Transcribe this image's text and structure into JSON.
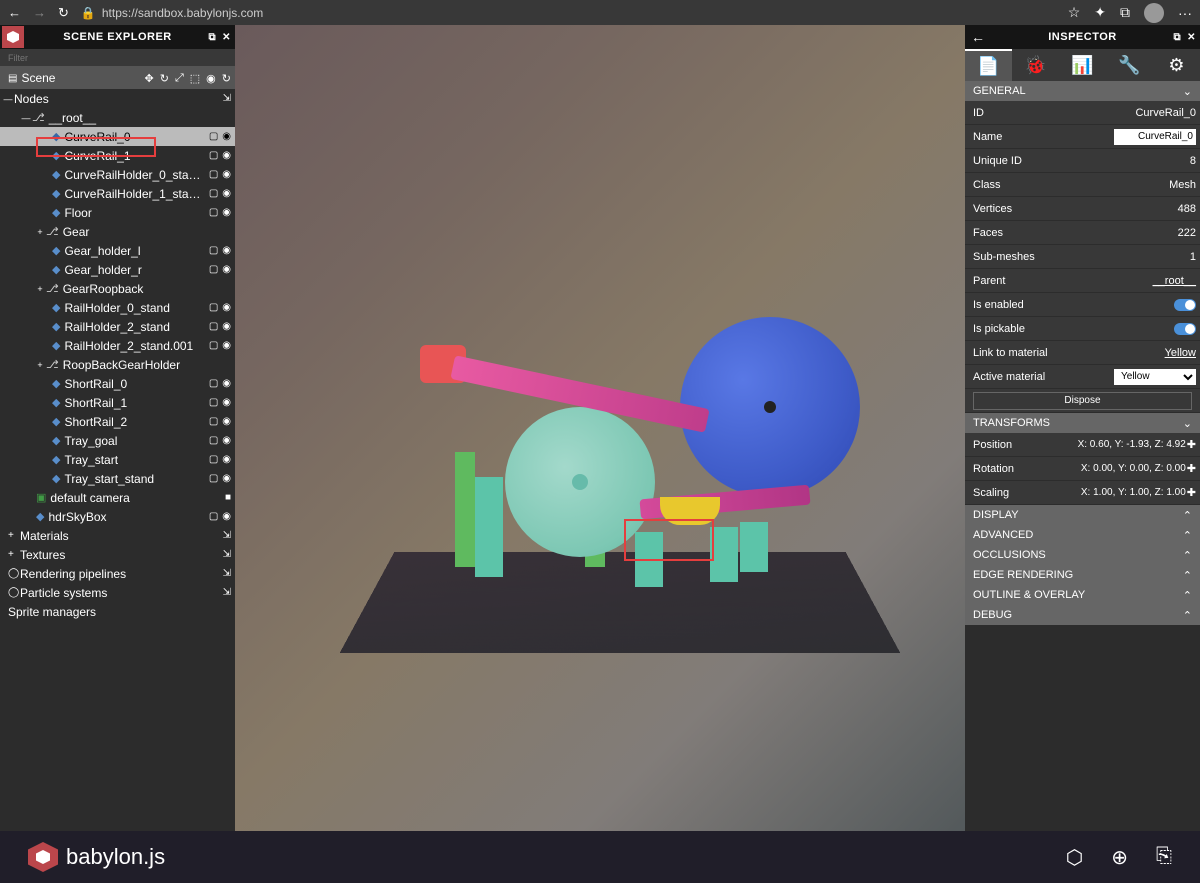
{
  "browser": {
    "url": "https://sandbox.babylonjs.com"
  },
  "scene_explorer": {
    "title": "SCENE EXPLORER",
    "filter_placeholder": "Filter",
    "scene_label": "Scene",
    "nodes_label": "Nodes",
    "root_label": "__root__",
    "nodes": [
      {
        "label": "CurveRail_0",
        "indent": 52,
        "expandable": false,
        "selected": true
      },
      {
        "label": "CurveRail_1",
        "indent": 52,
        "expandable": false
      },
      {
        "label": "CurveRailHolder_0_sta…",
        "indent": 52,
        "expandable": false
      },
      {
        "label": "CurveRailHolder_1_sta…",
        "indent": 52,
        "expandable": false
      },
      {
        "label": "Floor",
        "indent": 52,
        "expandable": false
      },
      {
        "label": "Gear",
        "indent": 52,
        "expandable": true,
        "transform": true
      },
      {
        "label": "Gear_holder_l",
        "indent": 52,
        "expandable": false
      },
      {
        "label": "Gear_holder_r",
        "indent": 52,
        "expandable": false
      },
      {
        "label": "GearRoopback",
        "indent": 52,
        "expandable": true,
        "transform": true
      },
      {
        "label": "RailHolder_0_stand",
        "indent": 52,
        "expandable": false
      },
      {
        "label": "RailHolder_2_stand",
        "indent": 52,
        "expandable": false
      },
      {
        "label": "RailHolder_2_stand.001",
        "indent": 52,
        "expandable": false
      },
      {
        "label": "RoopBackGearHolder",
        "indent": 52,
        "expandable": true,
        "transform": true
      },
      {
        "label": "ShortRail_0",
        "indent": 52,
        "expandable": false
      },
      {
        "label": "ShortRail_1",
        "indent": 52,
        "expandable": false
      },
      {
        "label": "ShortRail_2",
        "indent": 52,
        "expandable": false
      },
      {
        "label": "Tray_goal",
        "indent": 52,
        "expandable": false
      },
      {
        "label": "Tray_start",
        "indent": 52,
        "expandable": false
      },
      {
        "label": "Tray_start_stand",
        "indent": 52,
        "expandable": false
      }
    ],
    "camera_label": "default camera",
    "skybox_label": "hdrSkyBox",
    "categories": [
      {
        "label": "Materials",
        "icon": "+"
      },
      {
        "label": "Textures",
        "icon": "+"
      },
      {
        "label": "Rendering pipelines",
        "icon": "◯"
      },
      {
        "label": "Particle systems",
        "icon": "◯"
      }
    ],
    "sprite_managers": "Sprite managers"
  },
  "inspector": {
    "title": "INSPECTOR",
    "sections": {
      "general": {
        "title": "GENERAL",
        "id_label": "ID",
        "id_value": "CurveRail_0",
        "name_label": "Name",
        "name_value": "CurveRail_0",
        "unique_id_label": "Unique ID",
        "unique_id_value": "8",
        "class_label": "Class",
        "class_value": "Mesh",
        "vertices_label": "Vertices",
        "vertices_value": "488",
        "faces_label": "Faces",
        "faces_value": "222",
        "submeshes_label": "Sub-meshes",
        "submeshes_value": "1",
        "parent_label": "Parent",
        "parent_value": "__root__",
        "enabled_label": "Is enabled",
        "pickable_label": "Is pickable",
        "link_material_label": "Link to material",
        "link_material_value": "Yellow",
        "active_material_label": "Active material",
        "active_material_value": "Yellow",
        "dispose_label": "Dispose"
      },
      "transforms": {
        "title": "TRANSFORMS",
        "position_label": "Position",
        "position_value": "X: 0.60, Y: -1.93, Z: 4.92",
        "rotation_label": "Rotation",
        "rotation_value": "X: 0.00, Y: 0.00, Z: 0.00",
        "scaling_label": "Scaling",
        "scaling_value": "X: 1.00, Y: 1.00, Z: 1.00"
      },
      "display": "DISPLAY",
      "advanced": "ADVANCED",
      "occlusions": "OCCLUSIONS",
      "edge_rendering": "EDGE RENDERING",
      "outline_overlay": "OUTLINE & OVERLAY",
      "debug": "DEBUG"
    }
  },
  "footer": {
    "brand": "babylon.js"
  }
}
